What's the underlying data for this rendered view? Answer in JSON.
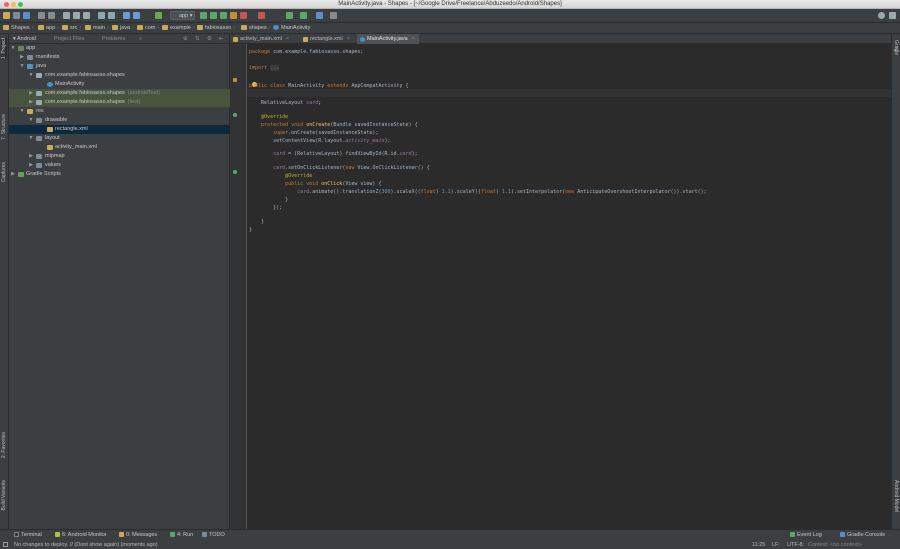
{
  "window": {
    "title": "MainActivity.java - Shapes - [~/Google Drive/Freelance/Abduzeedo/Android/Shapes]"
  },
  "toolbar": {
    "run_config": "app"
  },
  "breadcrumbs": [
    "Shapes",
    "app",
    "src",
    "main",
    "java",
    "com",
    "example",
    "fabiosasso",
    "shapes",
    "MainActivity"
  ],
  "left_tabs": {
    "project": "1: Project",
    "structure": "7: Structure",
    "captures": "Captures",
    "favorites": "2: Favorites",
    "build_variants": "Build Variants"
  },
  "right_tabs": {
    "gradle": "Gradle",
    "android_model": "Android Model"
  },
  "project_panel": {
    "tabs": [
      "Android",
      "Project Files",
      "Problems"
    ],
    "tree": [
      {
        "label": "app",
        "extra": ""
      },
      {
        "label": "manifests",
        "extra": ""
      },
      {
        "label": "java",
        "extra": ""
      },
      {
        "label": "com.example.fabiosasso.shapes",
        "extra": ""
      },
      {
        "label": "MainActivity",
        "extra": ""
      },
      {
        "label": "com.example.fabiosasso.shapes",
        "extra": "(androidTest)"
      },
      {
        "label": "com.example.fabiosasso.shapes",
        "extra": "(test)"
      },
      {
        "label": "res",
        "extra": ""
      },
      {
        "label": "drawable",
        "extra": ""
      },
      {
        "label": "rectangle.xml",
        "extra": ""
      },
      {
        "label": "layout",
        "extra": ""
      },
      {
        "label": "activity_main.xml",
        "extra": ""
      },
      {
        "label": "mipmap",
        "extra": ""
      },
      {
        "label": "values",
        "extra": ""
      },
      {
        "label": "Gradle Scripts",
        "extra": ""
      }
    ]
  },
  "editor": {
    "tabs": [
      "activity_main.xml",
      "rectangle.xml",
      "MainActivity.java"
    ],
    "code": {
      "l1a": "package ",
      "l1b": "com.example.fabiosasso.shapes;",
      "l2a": "import ",
      "l2b": "...",
      "l3a": "public class ",
      "l3b": "MainActivity ",
      "l3c": "extends ",
      "l3d": "AppCompatActivity {",
      "l4a": "    RelativeLayout ",
      "l4b": "card",
      "l5": "    @Override",
      "l6a": "    protected void ",
      "l6b": "onCreate",
      "l6c": "(Bundle savedInstanceState) {",
      "l7a": "        super",
      "l7b": ".onCreate(savedInstanceState);",
      "l8a": "        setContentView(R.layout.",
      "l8b": "activity_main",
      "l8c": ");",
      "l9a": "        ",
      "l9b": "card",
      "l9c": " = (RelativeLayout) findViewById(R.id.",
      "l9d": "card",
      "l9e": ");",
      "l10a": "        ",
      "l10b": "card",
      "l10c": ".setOnClickListener(",
      "l10d": "new ",
      "l10e": "View.OnClickListener() {",
      "l11": "            @Override",
      "l12a": "            public void ",
      "l12b": "onClick",
      "l12c": "(View view) {",
      "l13a": "                ",
      "l13b": "card",
      "l13c": ".animate().translationZ(",
      "l13d": "300",
      "l13e": ").scaleX((",
      "l13f": "float",
      "l13g": ") ",
      "l13h": "1.1",
      "l13i": ").scaleY((",
      "l13j": "float",
      "l13k": ") ",
      "l13l": "1.1",
      "l13m": ").setInterpolator(",
      "l13n": "new ",
      "l13o": "AnticipateOvershootInterpolator()).start();",
      "l14": "            }",
      "l15": "        });",
      "l16": "    }",
      "l17": "}"
    }
  },
  "bottom_tools": {
    "terminal": "Terminal",
    "android_monitor": "6: Android Monitor",
    "messages": "0: Messages",
    "run": "4: Run",
    "todo": "TODO",
    "event_log": "Event Log",
    "gradle_console": "Gradle Console"
  },
  "status": {
    "message": "No changes to deploy. // (Dont show again) (moments ago)",
    "position": "11:25",
    "line_sep": "LF:",
    "encoding": "UTF-8:",
    "context": "Context: <no context>"
  },
  "colors": {
    "bg": "#2b2b2b",
    "panel": "#3c3f41",
    "keyword": "#cc7832",
    "annotation": "#bbb529",
    "field": "#9876aa",
    "method": "#ffc66d",
    "number": "#6897bb"
  }
}
